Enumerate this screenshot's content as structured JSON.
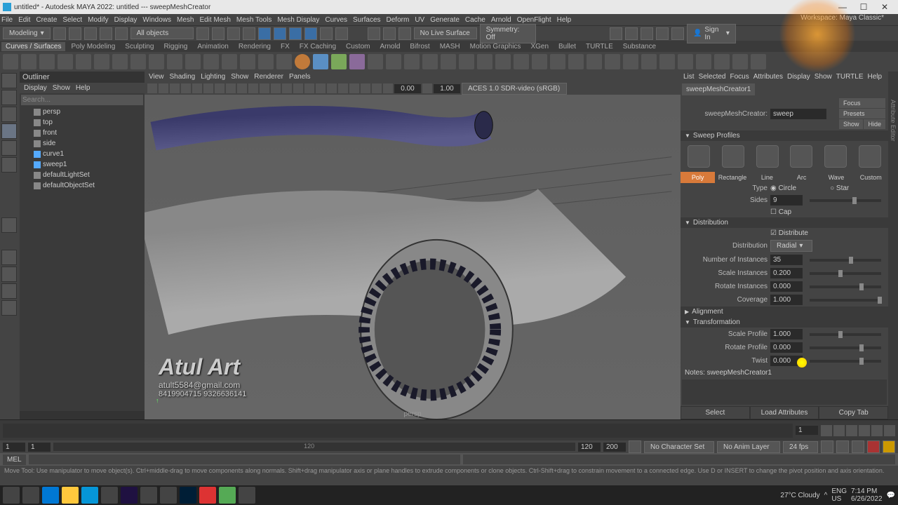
{
  "title": "untitled* - Autodesk MAYA 2022: untitled --- sweepMeshCreator",
  "workspace_label": "Workspace:",
  "workspace_value": "Maya Classic*",
  "menus": [
    "File",
    "Edit",
    "Create",
    "Select",
    "Modify",
    "Display",
    "Windows",
    "Mesh",
    "Edit Mesh",
    "Mesh Tools",
    "Mesh Display",
    "Curves",
    "Surfaces",
    "Deform",
    "UV",
    "Generate",
    "Cache",
    "Arnold",
    "OpenFlight",
    "Help"
  ],
  "mode": "Modeling",
  "objects_filter": "All objects",
  "no_live": "No Live Surface",
  "symmetry": "Symmetry: Off",
  "signin": "Sign In",
  "shelf_tabs": [
    "Curves / Surfaces",
    "Poly Modeling",
    "Sculpting",
    "Rigging",
    "Animation",
    "Rendering",
    "FX",
    "FX Caching",
    "Custom",
    "Arnold",
    "Bifrost",
    "MASH",
    "Motion Graphics",
    "XGen",
    "Bullet",
    "TURTLE",
    "Substance"
  ],
  "outliner": {
    "title": "Outliner",
    "menu": [
      "Display",
      "Show",
      "Help"
    ],
    "search": "Search...",
    "items": [
      "persp",
      "top",
      "front",
      "side",
      "curve1",
      "sweep1",
      "defaultLightSet",
      "defaultObjectSet"
    ]
  },
  "viewport": {
    "menu": [
      "View",
      "Shading",
      "Lighting",
      "Show",
      "Renderer",
      "Panels"
    ],
    "near": "0.00",
    "far": "1.00",
    "colorspace": "ACES 1.0 SDR-video (sRGB)",
    "label": "persp"
  },
  "watermark": {
    "line1": "Atul Art",
    "line2": "atult5584@gmail.com",
    "line3": "8419904715  9326636141"
  },
  "ae": {
    "menu": [
      "List",
      "Selected",
      "Focus",
      "Attributes",
      "Display",
      "Show",
      "TURTLE",
      "Help"
    ],
    "tab": "sweepMeshCreator1",
    "node_label": "sweepMeshCreator:",
    "node_value": "sweep",
    "btns": [
      "Focus",
      "Presets",
      "Show",
      "Hide"
    ],
    "sec_profiles": "Sweep Profiles",
    "profiles": [
      "Poly",
      "Rectangle",
      "Line",
      "Arc",
      "Wave",
      "Custom"
    ],
    "type_label": "Type",
    "type_opts": [
      "Circle",
      "Star"
    ],
    "sides_label": "Sides",
    "sides": "9",
    "cap_label": "Cap",
    "sec_dist": "Distribution",
    "distribute_label": "Distribute",
    "distribution_label": "Distribution",
    "distribution_val": "Radial",
    "instances_label": "Number of Instances",
    "instances": "35",
    "scale_inst_label": "Scale Instances",
    "scale_inst": "0.200",
    "rot_inst_label": "Rotate Instances",
    "rot_inst": "0.000",
    "coverage_label": "Coverage",
    "coverage": "1.000",
    "sec_align": "Alignment",
    "sec_trans": "Transformation",
    "scale_prof_label": "Scale Profile",
    "scale_prof": "1.000",
    "rot_prof_label": "Rotate Profile",
    "rot_prof": "0.000",
    "twist_label": "Twist",
    "twist": "0.000",
    "notes_label": "Notes: sweepMeshCreator1",
    "footer": [
      "Select",
      "Load Attributes",
      "Copy Tab"
    ]
  },
  "timeline": {
    "start": "1",
    "end": "120",
    "range_start": "1",
    "range_end": "120",
    "r2": "200",
    "cur": "1",
    "charset": "No Character Set",
    "animlayer": "No Anim Layer",
    "fps": "24 fps",
    "range_bar_end": "120"
  },
  "cmd": "MEL",
  "help": "Move Tool: Use manipulator to move object(s). Ctrl+middle-drag to move components along normals. Shift+drag manipulator axis or plane handles to extrude components or clone objects. Ctrl-Shift+drag to constrain movement to a connected edge. Use D or INSERT to change the pivot position and axis orientation.",
  "system": {
    "weather": "27°C  Cloudy",
    "lang": "ENG",
    "loc": "US",
    "time": "7:14 PM",
    "date": "6/26/2022"
  }
}
